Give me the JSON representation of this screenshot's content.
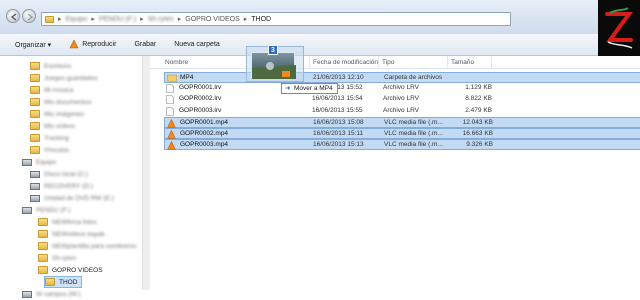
{
  "address_bar": {
    "crumbs": [
      {
        "text": "Equipo",
        "blurred": true
      },
      {
        "text": "PENDU (F:)",
        "blurred": true
      },
      {
        "text": "Sh.ryten",
        "blurred": true
      },
      {
        "text": "GOPRO VIDEOS",
        "blurred": false
      },
      {
        "text": "THOD",
        "blurred": false
      }
    ]
  },
  "toolbar": {
    "organize": "Organizar ▾",
    "play": "Reproducir",
    "burn": "Grabar",
    "new_folder": "Nueva carpeta"
  },
  "sidebar": {
    "items": [
      {
        "label": "Escritorio",
        "blurred": true,
        "kind": "folder"
      },
      {
        "label": "Juegos guardados",
        "blurred": true,
        "kind": "folder"
      },
      {
        "label": "Mi música",
        "blurred": true,
        "kind": "folder"
      },
      {
        "label": "Mis documentos",
        "blurred": true,
        "kind": "folder"
      },
      {
        "label": "Mis imágenes",
        "blurred": true,
        "kind": "folder"
      },
      {
        "label": "Mis vídeos",
        "blurred": true,
        "kind": "folder"
      },
      {
        "label": "Tracking",
        "blurred": true,
        "kind": "folder"
      },
      {
        "label": "Vínculos",
        "blurred": true,
        "kind": "folder"
      },
      {
        "label": "Equipo",
        "blurred": true,
        "kind": "drive"
      },
      {
        "label": "Disco local (C:)",
        "blurred": true,
        "kind": "drive"
      },
      {
        "label": "RECOVERY (D:)",
        "blurred": true,
        "kind": "drive"
      },
      {
        "label": "Unidad de DVD RW (E:)",
        "blurred": true,
        "kind": "drive"
      },
      {
        "label": "PENDU (F:)",
        "blurred": true,
        "kind": "drive"
      },
      {
        "label": "NEWfinca fotos",
        "blurred": true,
        "kind": "folder"
      },
      {
        "label": "NEWvideos kayak",
        "blurred": true,
        "kind": "folder"
      },
      {
        "label": "NEWplantilla para sombreros",
        "blurred": true,
        "kind": "folder"
      },
      {
        "label": "Sh.ryten",
        "blurred": true,
        "kind": "folder"
      },
      {
        "label": "GOPRO VIDEOS",
        "blurred": false,
        "kind": "folder"
      },
      {
        "label": "THOD",
        "blurred": false,
        "kind": "folder",
        "selected": true
      },
      {
        "label": "W campus (W:)",
        "blurred": true,
        "kind": "drive"
      }
    ]
  },
  "columns": {
    "name": "Nombre",
    "date": "Fecha de modificación",
    "type": "Tipo",
    "size": "Tamaño"
  },
  "files": [
    {
      "name": "MP4",
      "date": "21/06/2013 12:10",
      "type": "Carpeta de archivos",
      "size": "",
      "icon": "folder",
      "selected": true
    },
    {
      "name": "GOPR0001.lrv",
      "date": "16/06/2013 15:52",
      "type": "Archivo LRV",
      "size": "1.129 KB",
      "icon": "file",
      "selected": false
    },
    {
      "name": "GOPR0002.lrv",
      "date": "16/06/2013 15:54",
      "type": "Archivo LRV",
      "size": "8.822 KB",
      "icon": "file",
      "selected": false
    },
    {
      "name": "GOPR0003.lrv",
      "date": "16/06/2013 15:55",
      "type": "Archivo LRV",
      "size": "2.479 KB",
      "icon": "file",
      "selected": false
    },
    {
      "name": "GOPR0001.mp4",
      "date": "16/06/2013 15:08",
      "type": "VLC media file (.m...",
      "size": "12.043 KB",
      "icon": "vlc",
      "selected": true
    },
    {
      "name": "GOPR0002.mp4",
      "date": "16/06/2013 15:11",
      "type": "VLC media file (.m...",
      "size": "16.663 KB",
      "icon": "vlc",
      "selected": true
    },
    {
      "name": "GOPR0003.mp4",
      "date": "16/06/2013 15:13",
      "type": "VLC media file (.m...",
      "size": "9.326 KB",
      "icon": "vlc",
      "selected": true
    }
  ],
  "drag": {
    "count": "3",
    "tooltip": "Mover a MP4"
  },
  "colors": {
    "selection": "#c3daf5",
    "accent": "#2f66c9",
    "logo_bg": "#0a0a0a"
  }
}
